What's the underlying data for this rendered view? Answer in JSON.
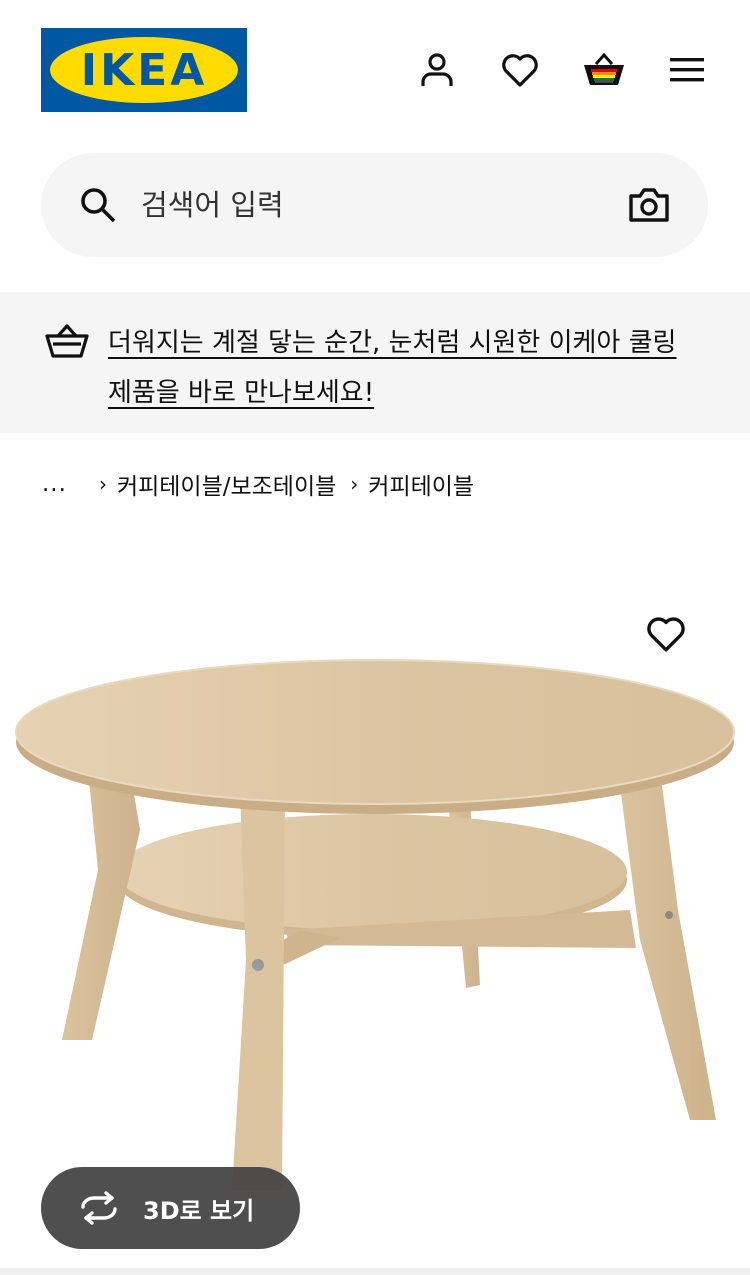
{
  "header": {
    "logo_text": "IKEA",
    "logo_mark": "®",
    "colors": {
      "logo_blue": "#0058a3",
      "logo_yellow": "#ffdb00"
    },
    "icons": [
      "user-icon",
      "heart-icon",
      "basket-icon",
      "menu-icon"
    ]
  },
  "search": {
    "placeholder": "검색어 입력",
    "icons": [
      "search-icon",
      "camera-icon"
    ]
  },
  "banner": {
    "text": "더워지는 계절 닿는 순간, 눈처럼 시원한 이케아 쿨링 제품을 바로 만나보세요!",
    "icon": "basket-icon"
  },
  "breadcrumb": {
    "ellipsis": "...",
    "items": [
      "커피테이블/보조테이블",
      "커피테이블"
    ]
  },
  "product": {
    "image_alt": "round coffee table",
    "icons": [
      "heart-icon"
    ],
    "view_3d_label": "3D로 보기"
  }
}
